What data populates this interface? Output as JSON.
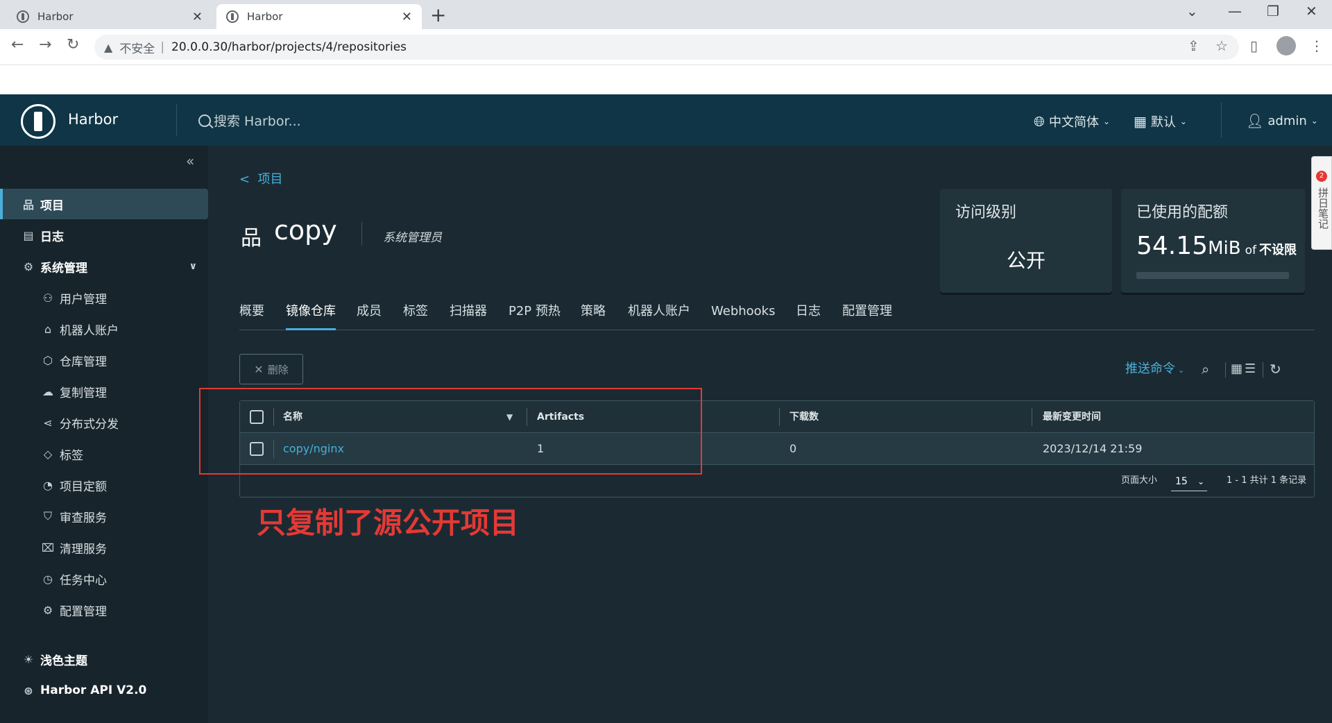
{
  "browser": {
    "tabs": [
      {
        "title": "Harbor"
      },
      {
        "title": "Harbor"
      }
    ],
    "new_tab": "+",
    "insecure_label": "不安全",
    "url": "20.0.0.30/harbor/projects/4/repositories"
  },
  "header": {
    "brand": "Harbor",
    "search_placeholder": "搜索 Harbor...",
    "language": "中文简体",
    "datetime_format": "默认",
    "user": "admin"
  },
  "sidebar": {
    "items": [
      {
        "label": "项目",
        "icon": "project-icon"
      },
      {
        "label": "日志",
        "icon": "log-icon"
      },
      {
        "label": "系统管理",
        "icon": "admin-icon"
      }
    ],
    "admin_sub": [
      {
        "label": "用户管理",
        "icon": "users-icon"
      },
      {
        "label": "机器人账户",
        "icon": "robot-icon"
      },
      {
        "label": "仓库管理",
        "icon": "registry-icon"
      },
      {
        "label": "复制管理",
        "icon": "replication-icon"
      },
      {
        "label": "分布式分发",
        "icon": "distribution-icon"
      },
      {
        "label": "标签",
        "icon": "label-icon"
      },
      {
        "label": "项目定额",
        "icon": "quota-icon"
      },
      {
        "label": "审查服务",
        "icon": "shield-icon"
      },
      {
        "label": "清理服务",
        "icon": "trash-icon"
      },
      {
        "label": "任务中心",
        "icon": "dashboard-icon"
      },
      {
        "label": "配置管理",
        "icon": "gear-icon"
      }
    ],
    "bottom": [
      {
        "label": "浅色主题",
        "icon": "sun-icon"
      },
      {
        "label": "Harbor API V2.0",
        "icon": "api-icon"
      }
    ]
  },
  "project": {
    "back_label": "项目",
    "back_arrow": "<",
    "name": "copy",
    "role": "系统管理员",
    "access_level_title": "访问级别",
    "access_level": "公开",
    "quota_title": "已使用的配额",
    "quota_value": "54.15",
    "quota_unit": "MiB",
    "quota_of": "of",
    "quota_limit": "不设限"
  },
  "tabs": [
    "概要",
    "镜像仓库",
    "成员",
    "标签",
    "扫描器",
    "P2P 预热",
    "策略",
    "机器人账户",
    "Webhooks",
    "日志",
    "配置管理"
  ],
  "active_tab": "镜像仓库",
  "toolbar": {
    "delete_label": "删除",
    "push_command": "推送命令"
  },
  "table": {
    "columns": [
      "名称",
      "Artifacts",
      "下载数",
      "最新变更时间"
    ],
    "rows": [
      {
        "name": "copy/nginx",
        "artifacts": "1",
        "downloads": "0",
        "updated": "2023/12/14 21:59"
      }
    ],
    "page_size_label": "页面大小",
    "page_size": "15",
    "summary": "1 - 1 共计 1 条记录"
  },
  "annotation": "只复制了源公开项目",
  "side_widget": {
    "badge": "2",
    "text": "拼日笔记"
  },
  "colors": {
    "header_bg": "#0f3546",
    "sidebar_bg": "#17242b",
    "main_bg": "#1b2a32",
    "accent": "#49afd9",
    "annotation": "#e53935"
  }
}
